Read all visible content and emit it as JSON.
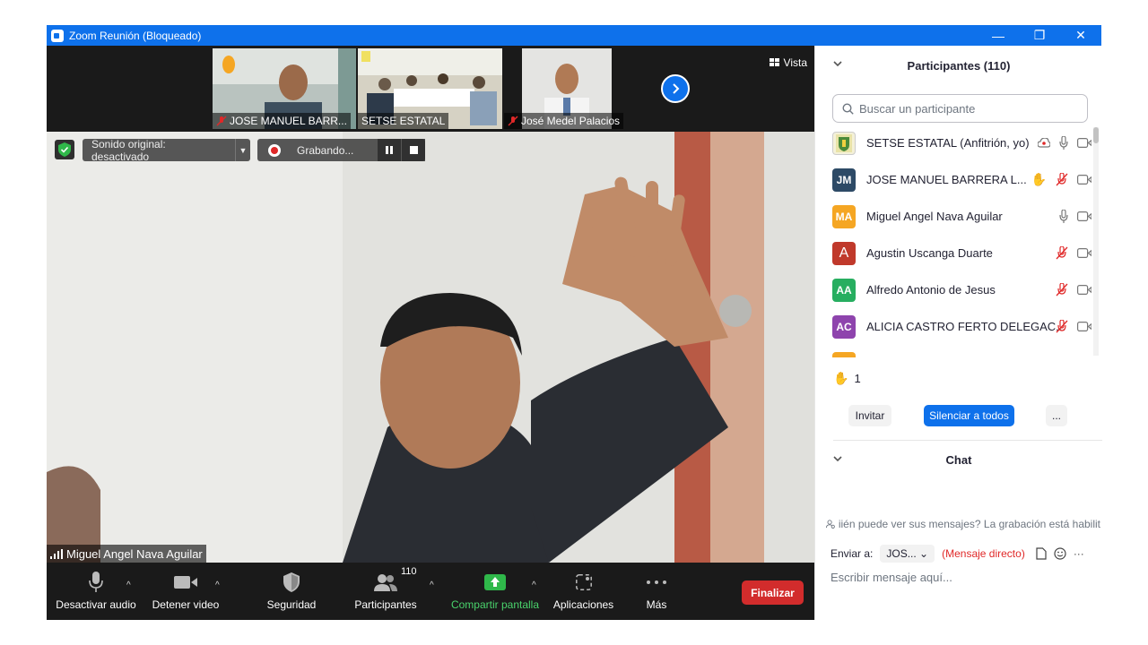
{
  "window": {
    "title": "Zoom Reunión (Bloqueado)",
    "minimize": "—",
    "restore": "❐",
    "close": "✕"
  },
  "strip": {
    "thumbs": [
      {
        "name": "JOSE MANUEL BARR...",
        "colors": [
          "#9aa8a4",
          "#cfd3cf"
        ]
      },
      {
        "name": "SETSE ESTATAL",
        "colors": [
          "#d6d2c4",
          "#8a8a80"
        ]
      },
      {
        "name": "José Medel Palacios",
        "colors": [
          "#e4e4e2",
          "#c8c8c6"
        ]
      }
    ],
    "next_icon": "chevron-right-icon",
    "view_label": "Vista"
  },
  "main": {
    "security_icon": "shield-check-icon",
    "sound_label": "Sonido original: desactivado",
    "recording_label": "Grabando...",
    "speaker_name": "Miguel Angel Nava Aguilar"
  },
  "toolbar": {
    "audio_label": "Desactivar audio",
    "video_label": "Detener video",
    "security_label": "Seguridad",
    "participants_label": "Participantes",
    "participants_count": "110",
    "share_label": "Compartir pantalla",
    "apps_label": "Aplicaciones",
    "more_label": "Más",
    "end_label": "Finalizar"
  },
  "panel": {
    "title": "Participantes (110)",
    "search_placeholder": "Buscar un participante",
    "participants": [
      {
        "name": "SETSE ESTATAL (Anfitrión, yo)",
        "initials": "",
        "color": "#e8e8e0",
        "muted": false,
        "hand": false,
        "host": true
      },
      {
        "name": "JOSE MANUEL BARRERA L...",
        "initials": "JM",
        "color": "#2d4a66",
        "muted": true,
        "hand": true,
        "host": false
      },
      {
        "name": "Miguel Angel Nava Aguilar",
        "initials": "MA",
        "color": "#f5a623",
        "muted": false,
        "hand": false,
        "host": false
      },
      {
        "name": "Agustin Uscanga Duarte",
        "initials": "A",
        "color": "#c0392b",
        "muted": true,
        "hand": false,
        "host": false
      },
      {
        "name": "Alfredo Antonio de Jesus",
        "initials": "AA",
        "color": "#27ae60",
        "muted": true,
        "hand": false,
        "host": false
      },
      {
        "name": "ALICIA CASTRO FERTO DELEGAC...",
        "initials": "AC",
        "color": "#8e44ad",
        "muted": true,
        "hand": false,
        "host": false
      },
      {
        "name": "",
        "initials": "",
        "color": "#f5a623",
        "muted": true,
        "hand": false,
        "host": false
      }
    ],
    "raised_hands": "1",
    "invite_label": "Invitar",
    "mute_all_label": "Silenciar a todos",
    "more_label": "...",
    "chat_title": "Chat",
    "chat_notice": "iién puede ver sus mensajes? La grabación está habilit",
    "send_to_label": "Enviar a:",
    "send_to_value": "JOS...",
    "direct_label": "(Mensaje directo)",
    "compose_placeholder": "Escribir mensaje aquí..."
  }
}
